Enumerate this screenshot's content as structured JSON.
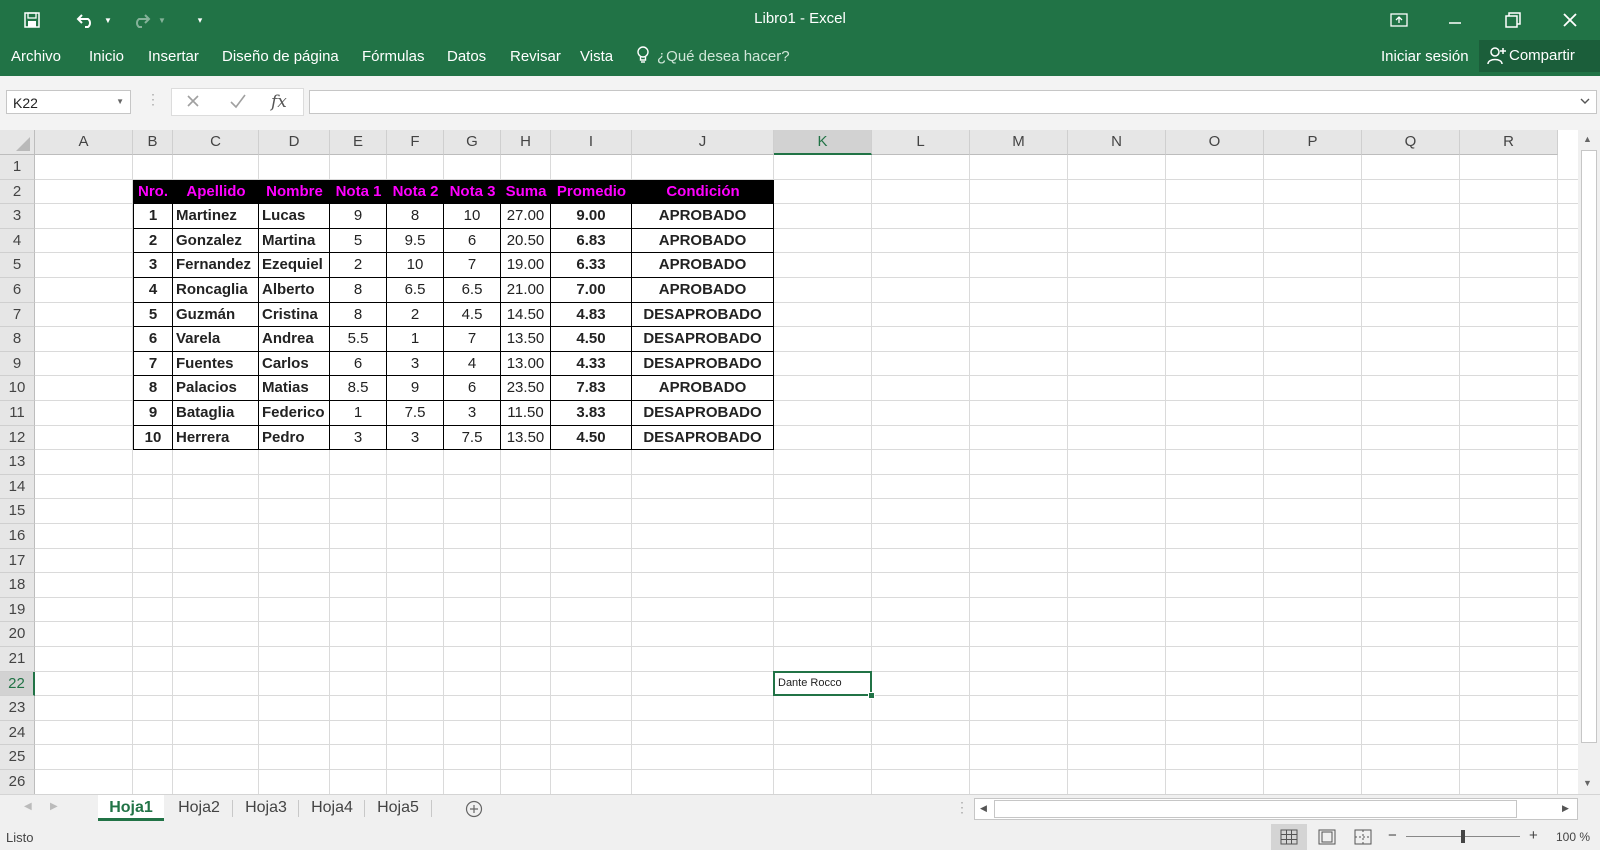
{
  "app": {
    "title": "Libro1 - Excel",
    "accent": "#217346"
  },
  "ribbon": {
    "tabs": [
      "Archivo",
      "Inicio",
      "Insertar",
      "Diseño de página",
      "Fórmulas",
      "Datos",
      "Revisar",
      "Vista"
    ],
    "tell_me": "¿Qué desea hacer?",
    "sign_in": "Iniciar sesión",
    "share": "Compartir"
  },
  "formula_bar": {
    "name_box": "K22",
    "fx_label": "fx",
    "content": ""
  },
  "grid": {
    "columns": [
      "A",
      "B",
      "C",
      "D",
      "E",
      "F",
      "G",
      "H",
      "I",
      "J",
      "K",
      "L",
      "M",
      "N",
      "O",
      "P",
      "Q",
      "R"
    ],
    "selected_column": "K",
    "rows": [
      "1",
      "2",
      "3",
      "4",
      "5",
      "6",
      "7",
      "8",
      "9",
      "10",
      "11",
      "12",
      "13",
      "14",
      "15",
      "16",
      "17",
      "18",
      "19",
      "20",
      "21",
      "22",
      "23",
      "24",
      "25",
      "26"
    ],
    "selected_row": "22",
    "header_color": "#ff00ff"
  },
  "table": {
    "headers": [
      "Nro.",
      "Apellido",
      "Nombre",
      "Nota 1",
      "Nota 2",
      "Nota 3",
      "Suma",
      "Promedio",
      "Condición"
    ],
    "rows": [
      [
        "1",
        "Martinez",
        "Lucas",
        "9",
        "8",
        "10",
        "27.00",
        "9.00",
        "APROBADO"
      ],
      [
        "2",
        "Gonzalez",
        "Martina",
        "5",
        "9.5",
        "6",
        "20.50",
        "6.83",
        "APROBADO"
      ],
      [
        "3",
        "Fernandez",
        "Ezequiel",
        "2",
        "10",
        "7",
        "19.00",
        "6.33",
        "APROBADO"
      ],
      [
        "4",
        "Roncaglia",
        "Alberto",
        "8",
        "6.5",
        "6.5",
        "21.00",
        "7.00",
        "APROBADO"
      ],
      [
        "5",
        "Guzmán",
        "Cristina",
        "8",
        "2",
        "4.5",
        "14.50",
        "4.83",
        "DESAPROBADO"
      ],
      [
        "6",
        "Varela",
        "Andrea",
        "5.5",
        "1",
        "7",
        "13.50",
        "4.50",
        "DESAPROBADO"
      ],
      [
        "7",
        "Fuentes",
        "Carlos",
        "6",
        "3",
        "4",
        "13.00",
        "4.33",
        "DESAPROBADO"
      ],
      [
        "8",
        "Palacios",
        "Matias",
        "8.5",
        "9",
        "6",
        "23.50",
        "7.83",
        "APROBADO"
      ],
      [
        "9",
        "Bataglia",
        "Federico",
        "1",
        "7.5",
        "3",
        "11.50",
        "3.83",
        "DESAPROBADO"
      ],
      [
        "10",
        "Herrera",
        "Pedro",
        "3",
        "3",
        "7.5",
        "13.50",
        "4.50",
        "DESAPROBADO"
      ]
    ]
  },
  "active_cell": {
    "ref": "K22",
    "value": "Dante Rocco"
  },
  "sheets": {
    "tabs": [
      "Hoja1",
      "Hoja2",
      "Hoja3",
      "Hoja4",
      "Hoja5"
    ],
    "active": "Hoja1"
  },
  "status": {
    "ready": "Listo",
    "zoom": "100 %"
  }
}
